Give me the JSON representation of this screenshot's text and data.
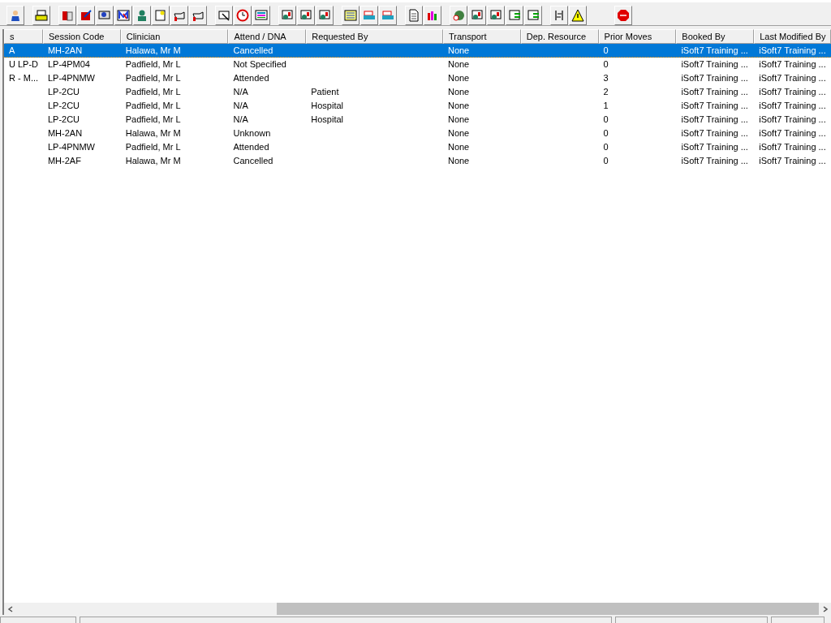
{
  "table": {
    "columns": [
      "s",
      "Session Code",
      "Clinician",
      "Attend / DNA",
      "Requested By",
      "Transport",
      "Dep. Resource",
      "Prior Moves",
      "Booked By",
      "Last Modified By"
    ],
    "rows": [
      {
        "selected": true,
        "cells": [
          "A",
          "MH-2AN",
          "Halawa, Mr M",
          "Cancelled",
          "",
          "None",
          "",
          "0",
          "iSoft7 Training ...",
          "iSoft7 Training ..."
        ]
      },
      {
        "selected": false,
        "cells": [
          "U LP-D",
          "LP-4PM04",
          "Padfield, Mr L",
          "Not Specified",
          "",
          "None",
          "",
          "0",
          "iSoft7 Training ...",
          "iSoft7 Training ..."
        ]
      },
      {
        "selected": false,
        "cells": [
          "R - M...",
          "LP-4PNMW",
          "Padfield, Mr L",
          "Attended",
          "",
          "None",
          "",
          "3",
          "iSoft7 Training ...",
          "iSoft7 Training ..."
        ]
      },
      {
        "selected": false,
        "cells": [
          "",
          "LP-2CU",
          "Padfield, Mr L",
          "N/A",
          "Patient",
          "None",
          "",
          "2",
          "iSoft7 Training ...",
          "iSoft7 Training ..."
        ]
      },
      {
        "selected": false,
        "cells": [
          "",
          "LP-2CU",
          "Padfield, Mr L",
          "N/A",
          "Hospital",
          "None",
          "",
          "1",
          "iSoft7 Training ...",
          "iSoft7 Training ..."
        ]
      },
      {
        "selected": false,
        "cells": [
          "",
          "LP-2CU",
          "Padfield, Mr L",
          "N/A",
          "Hospital",
          "None",
          "",
          "0",
          "iSoft7 Training ...",
          "iSoft7 Training ..."
        ]
      },
      {
        "selected": false,
        "cells": [
          "",
          "MH-2AN",
          "Halawa, Mr M",
          "Unknown",
          "",
          "None",
          "",
          "0",
          "iSoft7 Training ...",
          "iSoft7 Training ..."
        ]
      },
      {
        "selected": false,
        "cells": [
          "",
          "LP-4PNMW",
          "Padfield, Mr L",
          "Attended",
          "",
          "None",
          "",
          "0",
          "iSoft7 Training ...",
          "iSoft7 Training ..."
        ]
      },
      {
        "selected": false,
        "cells": [
          "",
          "MH-2AF",
          "Halawa, Mr M",
          "Cancelled",
          "",
          "None",
          "",
          "0",
          "iSoft7 Training ...",
          "iSoft7 Training ..."
        ]
      }
    ]
  }
}
